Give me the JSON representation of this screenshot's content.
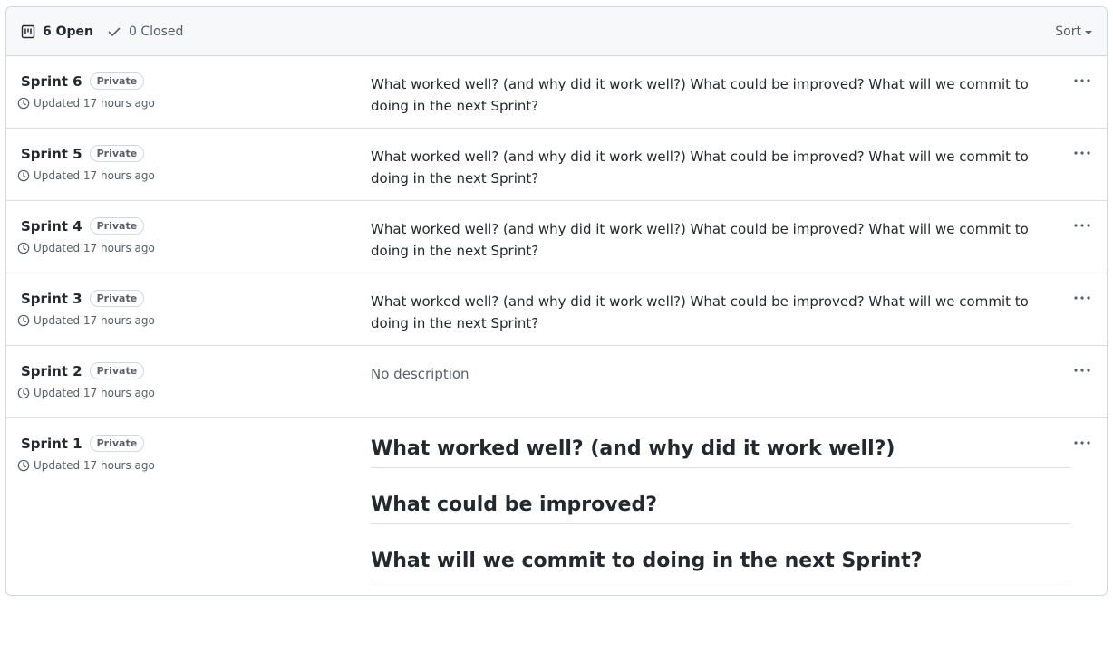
{
  "header": {
    "open_count": "6 Open",
    "closed_count": "0 Closed",
    "sort_label": "Sort"
  },
  "projects": [
    {
      "name": "Sprint 6",
      "visibility": "Private",
      "updated": "Updated 17 hours ago",
      "description": "What worked well? (and why did it work well?) What could be improved? What will we commit to doing in the next Sprint?"
    },
    {
      "name": "Sprint 5",
      "visibility": "Private",
      "updated": "Updated 17 hours ago",
      "description": "What worked well? (and why did it work well?) What could be improved? What will we commit to doing in the next Sprint?"
    },
    {
      "name": "Sprint 4",
      "visibility": "Private",
      "updated": "Updated 17 hours ago",
      "description": "What worked well? (and why did it work well?) What could be improved? What will we commit to doing in the next Sprint?"
    },
    {
      "name": "Sprint 3",
      "visibility": "Private",
      "updated": "Updated 17 hours ago",
      "description": "What worked well? (and why did it work well?) What could be improved? What will we commit to doing in the next Sprint?"
    },
    {
      "name": "Sprint 2",
      "visibility": "Private",
      "updated": "Updated 17 hours ago",
      "description": "No description"
    },
    {
      "name": "Sprint 1",
      "visibility": "Private",
      "updated": "Updated 17 hours ago",
      "headings": [
        "What worked well? (and why did it work well?)",
        "What could be improved?",
        "What will we commit to doing in the next Sprint?"
      ]
    }
  ],
  "colors": {
    "text": "#24292f",
    "muted": "#57606a",
    "border": "#d0d7de",
    "header_bg": "#f6f8fa"
  },
  "icons": [
    "project-board-icon",
    "check-icon",
    "chevron-down-icon",
    "clock-icon",
    "kebab-horizontal-icon"
  ]
}
